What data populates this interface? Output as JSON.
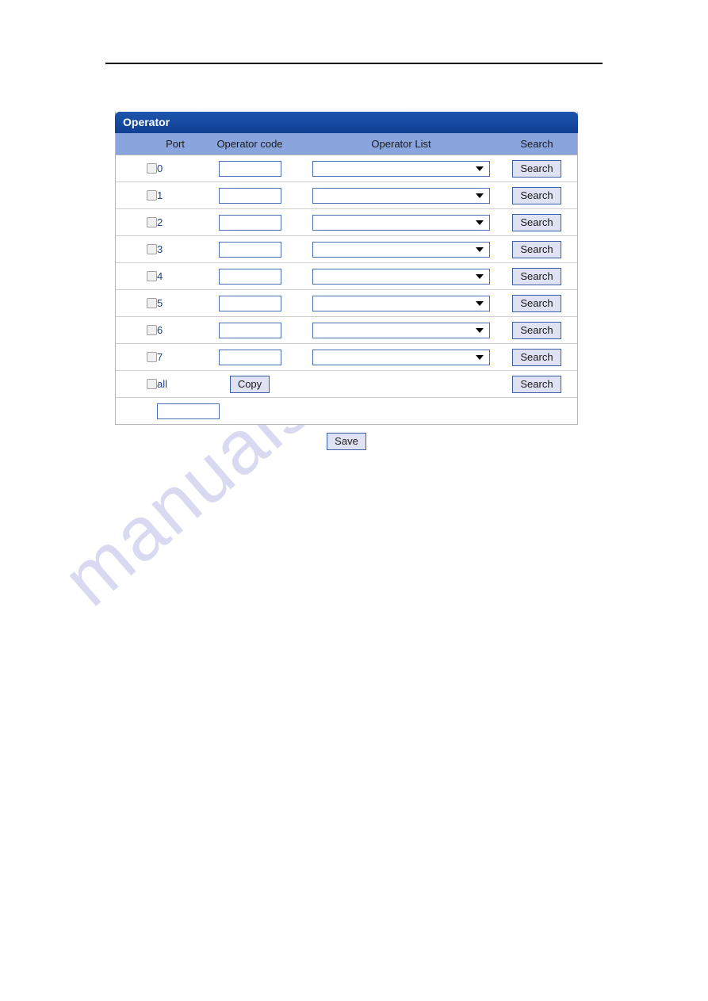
{
  "panel": {
    "title": "Operator"
  },
  "table": {
    "columns": [
      "",
      "Port",
      "Operator code",
      "Operator List",
      "Search"
    ],
    "rows": [
      {
        "port": "0",
        "code_value": "",
        "list_value": "",
        "search_label": "Search"
      },
      {
        "port": "1",
        "code_value": "",
        "list_value": "",
        "search_label": "Search"
      },
      {
        "port": "2",
        "code_value": "",
        "list_value": "",
        "search_label": "Search"
      },
      {
        "port": "3",
        "code_value": "",
        "list_value": "",
        "search_label": "Search"
      },
      {
        "port": "4",
        "code_value": "",
        "list_value": "",
        "search_label": "Search"
      },
      {
        "port": "5",
        "code_value": "",
        "list_value": "",
        "search_label": "Search"
      },
      {
        "port": "6",
        "code_value": "",
        "list_value": "",
        "search_label": "Search"
      },
      {
        "port": "7",
        "code_value": "",
        "list_value": "",
        "search_label": "Search"
      }
    ],
    "all_row": {
      "port": "all",
      "copy_label": "Copy",
      "search_label": "Search"
    },
    "extra_row": {
      "input_value": ""
    }
  },
  "actions": {
    "save_label": "Save"
  },
  "watermark": {
    "text": "manualshive.com"
  },
  "colors": {
    "title_bar": "#14499f",
    "column_header": "#8aa5de",
    "port_text": "#1b3f93",
    "field_border": "#4a6fb5",
    "button_face": "#dfe2f2",
    "button_border": "#3b5fa8",
    "watermark": "#d9d9f2"
  }
}
